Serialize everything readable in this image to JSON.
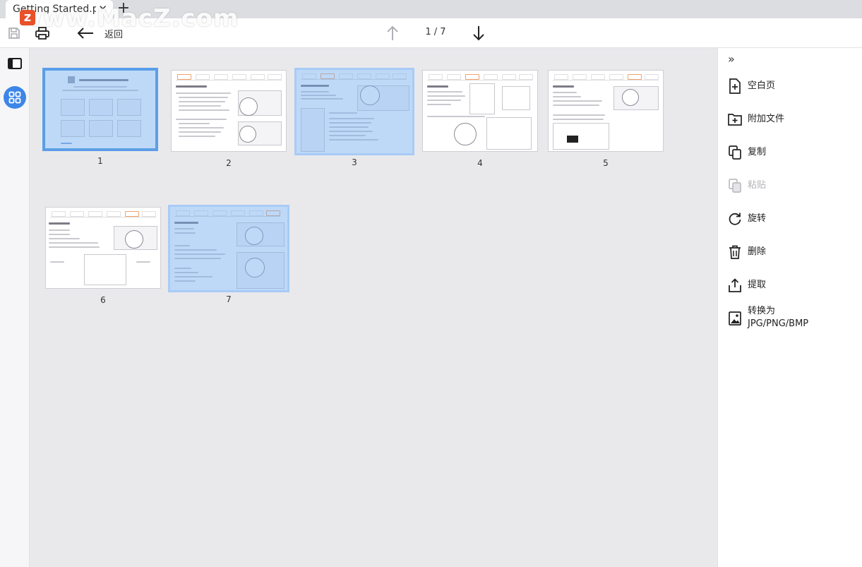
{
  "tab": {
    "title": "Getting Started.pdf",
    "close": "✕",
    "add": "+"
  },
  "watermark": {
    "logo_letter": "z",
    "text": "www.MacZ.com"
  },
  "toolbar": {
    "back_label": "返回",
    "current_page": "1",
    "separator": "/",
    "total_pages": "7"
  },
  "pages": [
    {
      "number": "1",
      "state": "selected"
    },
    {
      "number": "2",
      "state": "normal"
    },
    {
      "number": "3",
      "state": "selected-light"
    },
    {
      "number": "4",
      "state": "normal"
    },
    {
      "number": "5",
      "state": "normal"
    },
    {
      "number": "6",
      "state": "normal"
    },
    {
      "number": "7",
      "state": "selected-light"
    }
  ],
  "right_panel": {
    "collapse": "»",
    "actions": [
      {
        "id": "blank-page",
        "icon": "file-plus-icon",
        "label": "空白页",
        "enabled": true
      },
      {
        "id": "attach-file",
        "icon": "folder-plus-icon",
        "label": "附加文件",
        "enabled": true
      },
      {
        "id": "copy",
        "icon": "copy-icon",
        "label": "复制",
        "enabled": true
      },
      {
        "id": "paste",
        "icon": "paste-icon",
        "label": "粘贴",
        "enabled": false
      },
      {
        "id": "rotate",
        "icon": "rotate-icon",
        "label": "旋转",
        "enabled": true
      },
      {
        "id": "delete",
        "icon": "trash-icon",
        "label": "删除",
        "enabled": true
      },
      {
        "id": "extract",
        "icon": "share-icon",
        "label": "提取",
        "enabled": true
      },
      {
        "id": "convert",
        "icon": "image-icon",
        "label_line1": "转换为",
        "label_line2": "JPG/PNG/BMP",
        "enabled": true
      }
    ]
  },
  "colors": {
    "accent": "#3d86e8",
    "selection": "#5b9ee8"
  }
}
